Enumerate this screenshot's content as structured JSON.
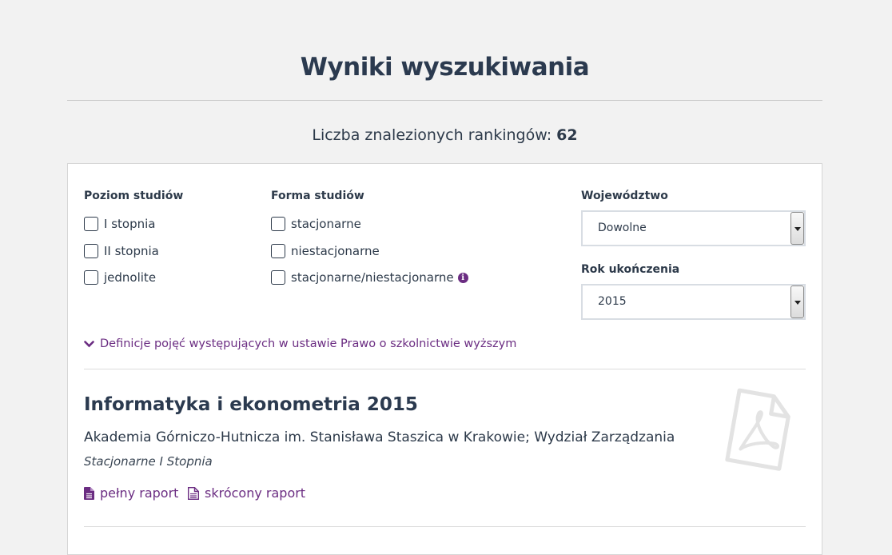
{
  "page": {
    "title": "Wyniki wyszukiwania",
    "count_label": "Liczba znalezionych rankingów:",
    "count_value": "62"
  },
  "filters": {
    "level": {
      "heading": "Poziom studiów",
      "options": [
        "I stopnia",
        "II stopnia",
        "jednolite"
      ]
    },
    "form": {
      "heading": "Forma studiów",
      "options": [
        "stacjonarne",
        "niestacjonarne",
        "stacjonarne/niestacjonarne"
      ]
    },
    "voivodeship": {
      "heading": "Województwo",
      "value": "Dowolne"
    },
    "year": {
      "heading": "Rok ukończenia",
      "value": "2015"
    },
    "definitions_link": "Definicje pojęć występujących w ustawie Prawo o szkolnictwie wyższym"
  },
  "result": {
    "title": "Informatyka i ekonometria 2015",
    "university": "Akademia Górniczo-Hutnicza im. Stanisława Staszica w Krakowie; Wydział Zarządzania",
    "mode": "Stacjonarne I Stopnia",
    "full_report": "pełny raport",
    "short_report": "skrócony raport"
  },
  "icons": {
    "info": "info-icon",
    "chevron": "chevron-down-icon",
    "full_report": "file-filled-icon",
    "short_report": "file-outline-icon",
    "pdf": "pdf-icon"
  },
  "colors": {
    "accent": "#6b2d82",
    "text": "#2d3a4a",
    "background": "#f2f2f2"
  }
}
